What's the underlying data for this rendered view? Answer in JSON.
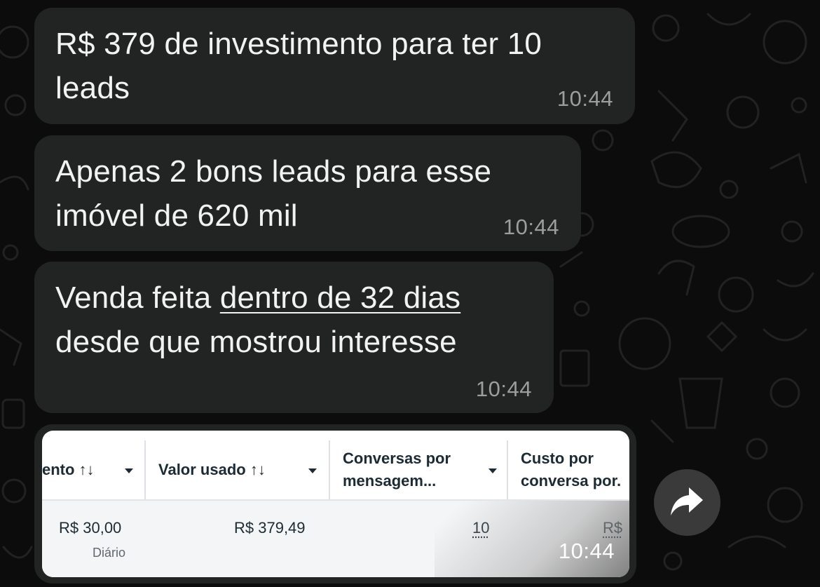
{
  "messages": [
    {
      "text": "R$ 379 de investimento para ter 10",
      "text2": "leads",
      "time": "10:44"
    },
    {
      "text": "Apenas 2 bons leads para esse",
      "text2": "imóvel de 620 mil",
      "time": "10:44"
    },
    {
      "text_pre": "Venda feita ",
      "text_underlined": "dentro de 32 dias",
      "text2": "desde que mostrou interesse",
      "time": "10:44"
    }
  ],
  "image_message": {
    "time": "10:44",
    "table": {
      "headers": [
        "ento ↑↓",
        "Valor usado ↑↓",
        "Conversas por",
        "mensagem...",
        "Custo por",
        "conversa por."
      ],
      "row": {
        "budget": "R$ 30,00",
        "budget_sub": "Diário",
        "spent": "R$ 379,49",
        "conversations": "10",
        "cost": "R$"
      }
    }
  },
  "icons": {
    "forward": "forward-arrow-icon"
  },
  "colors": {
    "background": "#0c0c0c",
    "bubble": "#222423",
    "text": "#f2f2f2",
    "timestamp": "#9c9e9d"
  }
}
